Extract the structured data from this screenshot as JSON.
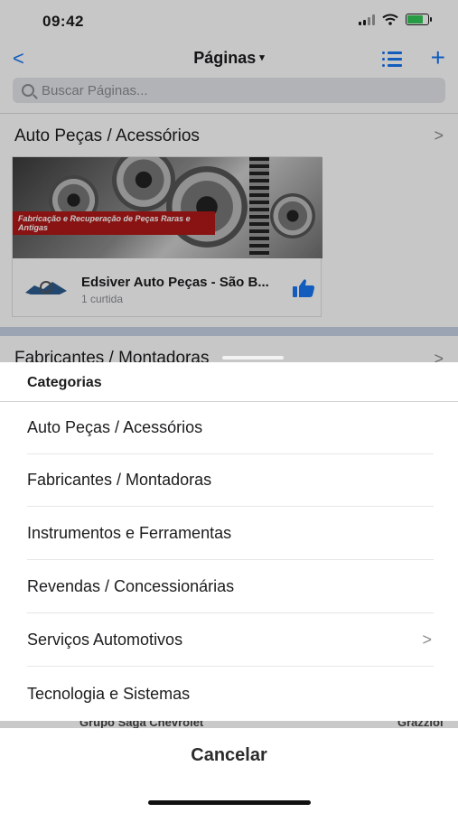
{
  "status": {
    "time": "09:42"
  },
  "nav": {
    "back": "<",
    "title": "Páginas",
    "caret": "▾",
    "plus": "+"
  },
  "search": {
    "placeholder": "Buscar Páginas..."
  },
  "sections": [
    {
      "label": "Auto Peças / Acessórios",
      "chevron": ">"
    },
    {
      "label": "Fabricantes / Montadoras",
      "chevron": ">"
    }
  ],
  "card": {
    "banner": "Fabricação e Recuperação de Peças Raras e Antigas",
    "name": "Edsiver Auto Peças - São B...",
    "likes": "1 curtida"
  },
  "sheet": {
    "title": "Categorias",
    "options": [
      {
        "label": "Auto Peças / Acessórios"
      },
      {
        "label": "Fabricantes / Montadoras"
      },
      {
        "label": "Instrumentos e Ferramentas"
      },
      {
        "label": "Revendas / Concessionárias"
      },
      {
        "label": "Serviços Automotivos",
        "chevron": ">"
      },
      {
        "label": "Tecnologia e Sistemas"
      }
    ],
    "cancel": "Cancelar"
  },
  "peek": {
    "left": "Grupo Saga Chevrolet",
    "right": "Grazziol"
  },
  "colors": {
    "accent": "#1877f2",
    "banner": "#b01818",
    "battery": "#34c759"
  }
}
